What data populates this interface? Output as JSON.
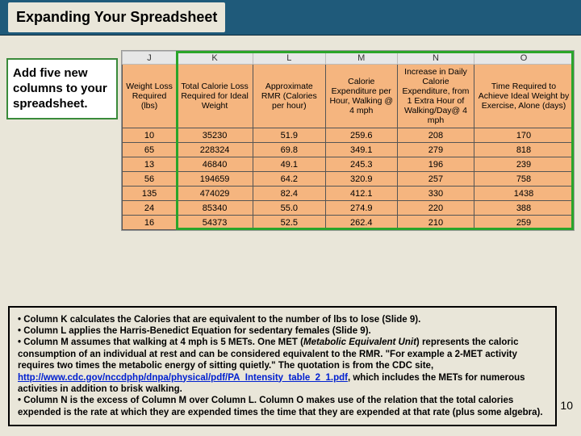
{
  "title": "Expanding Your Spreadsheet",
  "callout": "Add five new columns to your spreadsheet.",
  "columns": [
    "J",
    "K",
    "L",
    "M",
    "N",
    "O"
  ],
  "fields": [
    "Weight Loss Required (lbs)",
    "Total Calorie Loss Required for Ideal Weight",
    "Approximate RMR (Calories per hour)",
    "Calorie Expenditure per Hour, Walking @ 4 mph",
    "Increase in Daily Calorie Expenditure, from 1 Extra Hour of Walking/Day@ 4 mph",
    "Time Required to Achieve Ideal Weight by Exercise, Alone (days)"
  ],
  "rows": [
    [
      "10",
      "35230",
      "51.9",
      "259.6",
      "208",
      "170"
    ],
    [
      "65",
      "228324",
      "69.8",
      "349.1",
      "279",
      "818"
    ],
    [
      "13",
      "46840",
      "49.1",
      "245.3",
      "196",
      "239"
    ],
    [
      "56",
      "194659",
      "64.2",
      "320.9",
      "257",
      "758"
    ],
    [
      "135",
      "474029",
      "82.4",
      "412.1",
      "330",
      "1438"
    ],
    [
      "24",
      "85340",
      "55.0",
      "274.9",
      "220",
      "388"
    ],
    [
      "16",
      "54373",
      "52.5",
      "262.4",
      "210",
      "259"
    ]
  ],
  "notes": {
    "b1": "• Column K calculates the Calories that are equivalent to the number of lbs to lose (Slide 9).",
    "b2": "• Column L applies the Harris-Benedict Equation for sedentary females (Slide 9).",
    "b3a": "• Column M assumes that walking at 4 mph is 5 METs. One MET (",
    "b3em": "Metabolic Equivalent Unit",
    "b3b": ") represents the caloric consumption of an individual at rest and can be considered equivalent to the RMR. \"For example a 2-MET activity requires two times the metabolic energy of sitting quietly.\" The quotation is from the CDC site, ",
    "link": "http://www.cdc.gov/nccdphp/dnpa/physical/pdf/PA_Intensity_table_2_1.pdf",
    "b3c": ", which includes the METs for numerous activities in addition to brisk walking.",
    "b4": "• Column N is the excess of Column M over Column L. Column O makes use of the relation that the total calories expended is the rate at which they are expended times the time that they are expended at that rate (plus some algebra)."
  },
  "page": "10"
}
